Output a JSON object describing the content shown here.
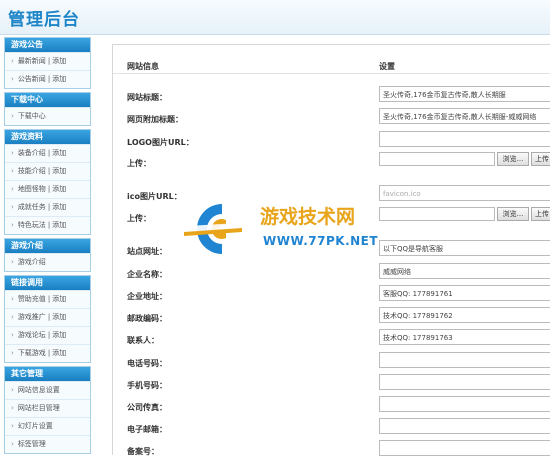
{
  "header": {
    "title": "管理后台"
  },
  "sidebar": {
    "groups": [
      {
        "title": "游戏公告",
        "items": [
          {
            "label": "最新新闻",
            "action": "添加"
          },
          {
            "label": "公告新闻",
            "action": "添加"
          }
        ]
      },
      {
        "title": "下载中心",
        "items": [
          {
            "label": "下载中心",
            "action": ""
          }
        ]
      },
      {
        "title": "游戏资料",
        "items": [
          {
            "label": "装备介绍",
            "action": "添加"
          },
          {
            "label": "技能介绍",
            "action": "添加"
          },
          {
            "label": "地图怪物",
            "action": "添加"
          },
          {
            "label": "成就任务",
            "action": "添加"
          },
          {
            "label": "特色玩法",
            "action": "添加"
          }
        ]
      },
      {
        "title": "游戏介绍",
        "items": [
          {
            "label": "游戏介绍",
            "action": ""
          }
        ]
      },
      {
        "title": "链接调用",
        "items": [
          {
            "label": "赞助充值",
            "action": "添加"
          },
          {
            "label": "游戏推广",
            "action": "添加"
          },
          {
            "label": "游戏论坛",
            "action": "添加"
          },
          {
            "label": "下载游戏",
            "action": "添加"
          }
        ]
      },
      {
        "title": "其它管理",
        "items": [
          {
            "label": "网站信息设置",
            "action": ""
          },
          {
            "label": "网站栏目管理",
            "action": ""
          },
          {
            "label": "幻灯片设置",
            "action": ""
          },
          {
            "label": "标签管理",
            "action": ""
          }
        ]
      }
    ],
    "separator": "|"
  },
  "form": {
    "col_label": "网站信息",
    "col_setting": "设置",
    "browse_label": "浏览...",
    "upload_label": "上传",
    "fields": {
      "site_title": {
        "label": "网站标题：",
        "value": "圣火传奇,176金币复古传奇,散人长期服"
      },
      "page_title": {
        "label": "网页附加标题：",
        "value": "圣火传奇,176金币复古传奇,散人长期服-威威网络"
      },
      "logo_url": {
        "label": "LOGO图片URL：",
        "value": ""
      },
      "upload1": {
        "label": "上传："
      },
      "ico_url": {
        "label": "ico图片URL：",
        "value": "favicon.ico"
      },
      "upload2": {
        "label": "上传："
      },
      "site_url": {
        "label": "站点网址：",
        "value": "以下QQ是导航客服"
      },
      "company": {
        "label": "企业名称：",
        "value": "威威网络"
      },
      "address": {
        "label": "企业地址：",
        "value": "客服QQ: 177891761"
      },
      "zipcode": {
        "label": "邮政编码：",
        "value": "技术QQ: 177891762"
      },
      "contact": {
        "label": "联系人：",
        "value": "技术QQ: 177891763"
      },
      "phone": {
        "label": "电话号码：",
        "value": ""
      },
      "mobile": {
        "label": "手机号码：",
        "value": ""
      },
      "fax": {
        "label": "公司传真：",
        "value": ""
      },
      "email": {
        "label": "电子邮箱：",
        "value": ""
      },
      "icp": {
        "label": "备案号：",
        "value": ""
      }
    }
  },
  "watermark": {
    "name": "游戏技术网",
    "url": "WWW.77PK.NET"
  },
  "colors": {
    "brand": "#1e86c8",
    "sidebar_header": "#1a7fc1",
    "watermark_orange": "#e8a41a",
    "watermark_blue": "#1f84d1"
  }
}
